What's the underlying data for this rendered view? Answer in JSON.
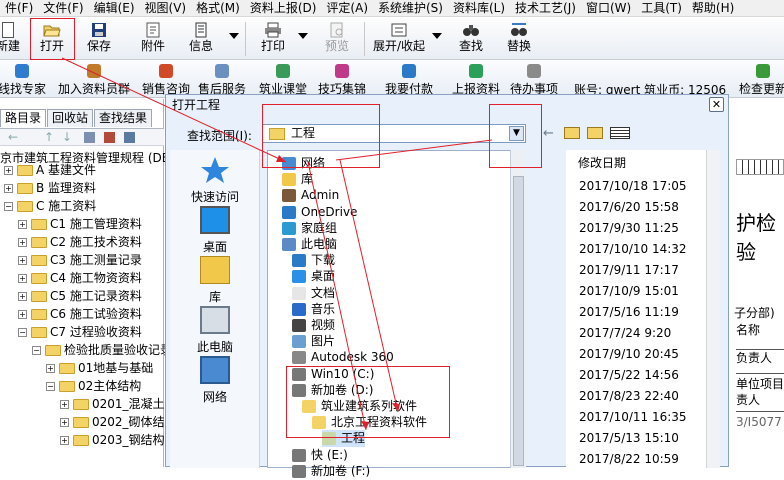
{
  "menu": [
    "件(F)",
    "文件(F)",
    "编辑(E)",
    "视图(V)",
    "格式(M)",
    "资料上报(D)",
    "评定(A)",
    "系统维护(S)",
    "资料库(L)",
    "技术工艺(J)",
    "窗口(W)",
    "工具(T)",
    "帮助(H)"
  ],
  "toolbar": {
    "new": "新建",
    "open": "打开",
    "save": "保存",
    "attachment": "附件",
    "info": "信息",
    "print": "打印",
    "preview": "预览",
    "expand_collapse": "展开/收起",
    "find": "查找",
    "replace": "替换"
  },
  "toolbar2": {
    "expert": "线找专家",
    "join_group": "加入资料员群",
    "sales": "销售咨询",
    "after_sales": "售后服务",
    "classroom": "筑业课堂",
    "tips": "技巧集锦",
    "pay": "我要付款",
    "upload": "上报资料",
    "todo": "待办事项",
    "account": "账号: qwert 筑业币: 12506",
    "check_update": "检查更新"
  },
  "left_panel": {
    "tabs": [
      "路目录",
      "回收站",
      "查找结果"
    ],
    "root": "京市建筑工程资料管理规程 (DB",
    "tree": [
      {
        "label": "A 基建文件",
        "level": 0,
        "pm": "+"
      },
      {
        "label": "B 监理资料",
        "level": 0,
        "pm": "+"
      },
      {
        "label": "C 施工资料",
        "level": 0,
        "pm": "−"
      },
      {
        "label": "C1 施工管理资料",
        "level": 1,
        "pm": "+"
      },
      {
        "label": "C2 施工技术资料",
        "level": 1,
        "pm": "+"
      },
      {
        "label": "C3 施工测量记录",
        "level": 1,
        "pm": "+"
      },
      {
        "label": "C4 施工物资资料",
        "level": 1,
        "pm": "+"
      },
      {
        "label": "C5 施工记录资料",
        "level": 1,
        "pm": "+"
      },
      {
        "label": "C6 施工试验资料",
        "level": 1,
        "pm": "+"
      },
      {
        "label": "C7 过程验收资料",
        "level": 1,
        "pm": "−"
      },
      {
        "label": "检验批质量验收记录",
        "level": 2,
        "pm": "−"
      },
      {
        "label": "01地基与基础",
        "level": 3,
        "pm": "+"
      },
      {
        "label": "02主体结构",
        "level": 3,
        "pm": "−"
      },
      {
        "label": "0201_混凝土",
        "level": 4,
        "pm": "+"
      },
      {
        "label": "0202_砌体结",
        "level": 4,
        "pm": "+"
      },
      {
        "label": "0203_钢结构",
        "level": 4,
        "pm": "+"
      }
    ]
  },
  "dialog": {
    "title": "打开工程",
    "lookin_label": "查找范围(I):",
    "lookin_value": "工程",
    "places": [
      "快速访问",
      "桌面",
      "库",
      "此电脑",
      "网络"
    ],
    "files": [
      {
        "label": "网络",
        "icon": "network-icon",
        "indent": 0
      },
      {
        "label": "库",
        "icon": "library-icon",
        "indent": 0
      },
      {
        "label": "Admin",
        "icon": "user-icon",
        "indent": 0
      },
      {
        "label": "OneDrive",
        "icon": "cloud-icon",
        "indent": 0
      },
      {
        "label": "家庭组",
        "icon": "homegroup-icon",
        "indent": 0
      },
      {
        "label": "此电脑",
        "icon": "computer-icon",
        "indent": 0
      },
      {
        "label": "下载",
        "icon": "download-icon",
        "indent": 1
      },
      {
        "label": "桌面",
        "icon": "desktop-icon",
        "indent": 1
      },
      {
        "label": "文档",
        "icon": "document-icon",
        "indent": 1
      },
      {
        "label": "音乐",
        "icon": "music-icon",
        "indent": 1
      },
      {
        "label": "视频",
        "icon": "video-icon",
        "indent": 1
      },
      {
        "label": "图片",
        "icon": "picture-icon",
        "indent": 1
      },
      {
        "label": "Autodesk 360",
        "icon": "autodesk-icon",
        "indent": 1
      },
      {
        "label": "Win10 (C:)",
        "icon": "drive-icon",
        "indent": 1
      },
      {
        "label": "新加卷 (D:)",
        "icon": "drive-icon",
        "indent": 1
      },
      {
        "label": "筑业建筑系列软件",
        "icon": "folder-icon",
        "indent": 2
      },
      {
        "label": "北京工程资料软件",
        "icon": "folder-icon",
        "indent": 3
      },
      {
        "label": "工程",
        "icon": "folder-open-icon",
        "indent": 4
      },
      {
        "label": "快 (E:)",
        "icon": "drive-icon",
        "indent": 1
      },
      {
        "label": "新加卷 (F:)",
        "icon": "drive-icon",
        "indent": 1
      }
    ],
    "date_header": "修改日期",
    "dates": [
      "2017/10/18 17:05",
      "2017/6/20 15:58",
      "2017/9/30 11:25",
      "2017/10/10 14:32",
      "2017/9/11 17:17",
      "2017/10/9 15:01",
      "2017/5/16 11:19",
      "2017/7/24 9:20",
      "2017/9/10 20:45",
      "2017/5/22 14:56",
      "2017/8/23 22:40",
      "2017/10/11 16:35",
      "2017/5/13 15:10",
      "2017/8/22 10:59"
    ]
  },
  "right_panel": {
    "doc_heading": "护检验",
    "lines": [
      "子分部)",
      "名称",
      "负责人",
      "单位项目",
      "责人",
      "3/I5077"
    ]
  },
  "colors": {
    "annotation": "#e0202a",
    "accent": "#3a78c8"
  }
}
